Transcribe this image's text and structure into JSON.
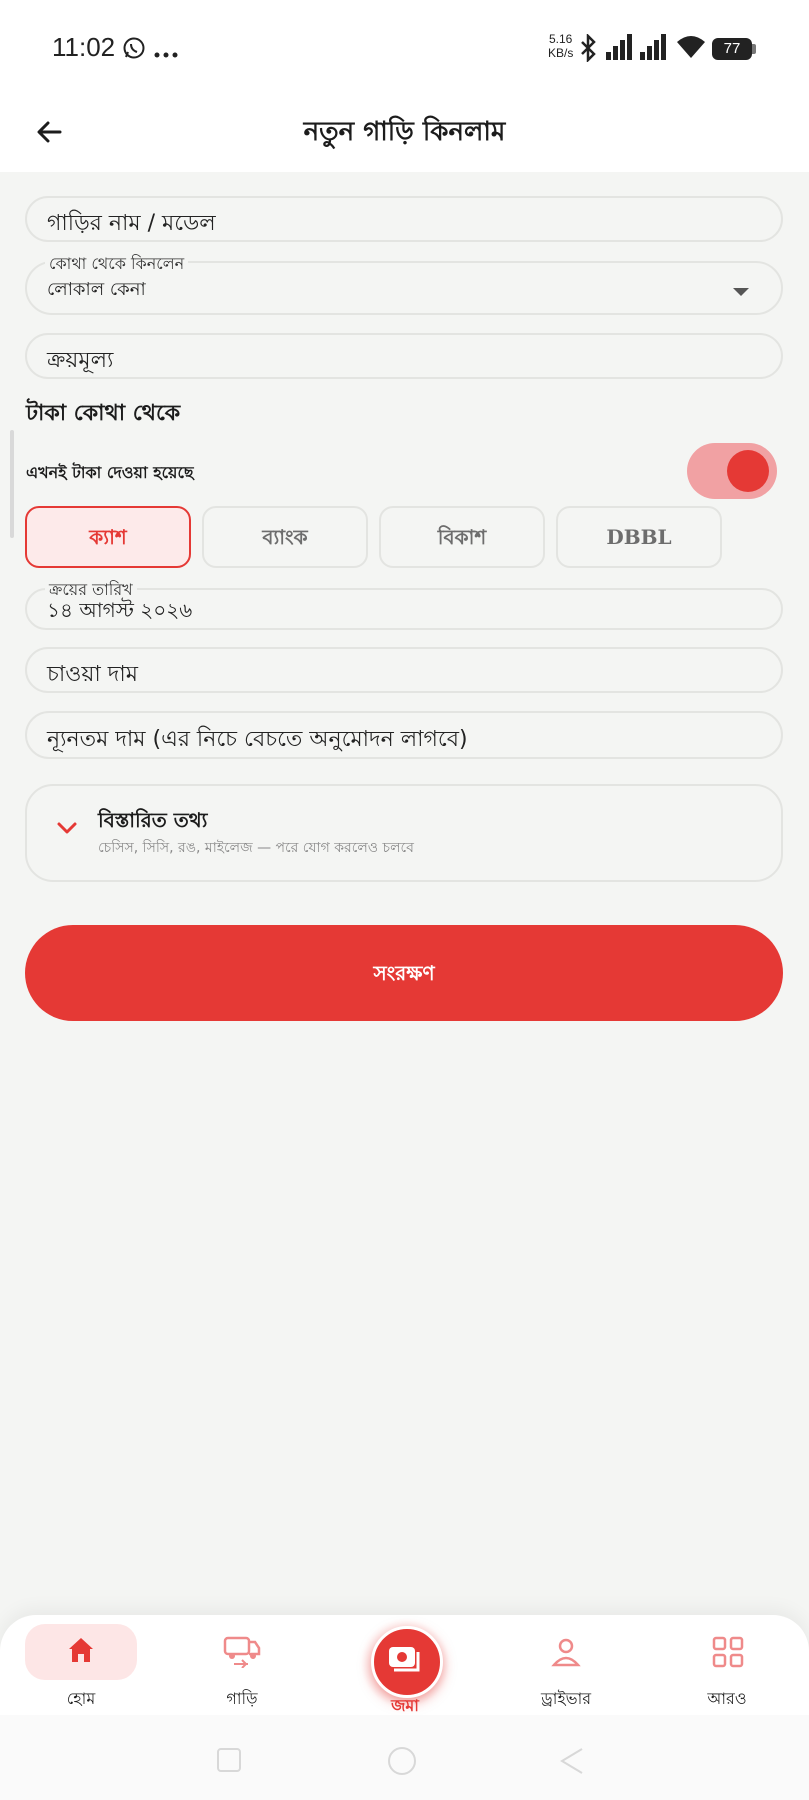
{
  "status_bar": {
    "time": "11:02",
    "net_speed_value": "5.16",
    "net_speed_unit": "KB/s",
    "battery": "77",
    "icons": [
      "whatsapp-icon",
      "more-icon",
      "bluetooth-icon",
      "signal-icon",
      "signal-icon",
      "wifi-icon",
      "battery-icon"
    ]
  },
  "header": {
    "title": "নতুন গাড়ি কিনলাম"
  },
  "form": {
    "car_name_placeholder": "গাড়ির নাম / মডেল",
    "source_label": "কোথা থেকে কিনলেন",
    "source_value": "লোকাল কেনা",
    "price_placeholder": "ক্রয়মূল্য",
    "money_section_title": "টাকা কোথা থেকে",
    "paid_now_label": "এখনই টাকা দেওয়া হয়েছে",
    "paid_now_on": true,
    "payment_methods": [
      "ক্যাশ",
      "ব্যাংক",
      "বিকাশ",
      "DBBL"
    ],
    "selected_payment": "ক্যাশ",
    "purchase_date_label": "ক্রয়ের তারিখ",
    "purchase_date_value": "১৪ আগস্ট ২০২৬",
    "asking_price_placeholder": "চাওয়া দাম",
    "min_price_placeholder": "ন্যূনতম দাম (এর নিচে বেচতে অনুমোদন লাগবে)",
    "details_title": "বিস্তারিত তথ্য",
    "details_subtitle": "চেসিস, সিসি, রঙ, মাইলেজ — পরে যোগ করলেও চলবে",
    "save_label": "সংরক্ষণ"
  },
  "bottom_nav": {
    "items": [
      "হোম",
      "গাড়ি",
      "জমা",
      "ড্রাইভার",
      "আরও"
    ],
    "active": "হোম"
  },
  "colors": {
    "accent": "#e53935",
    "background": "#f4f5f3",
    "border": "#e3e4e1"
  }
}
